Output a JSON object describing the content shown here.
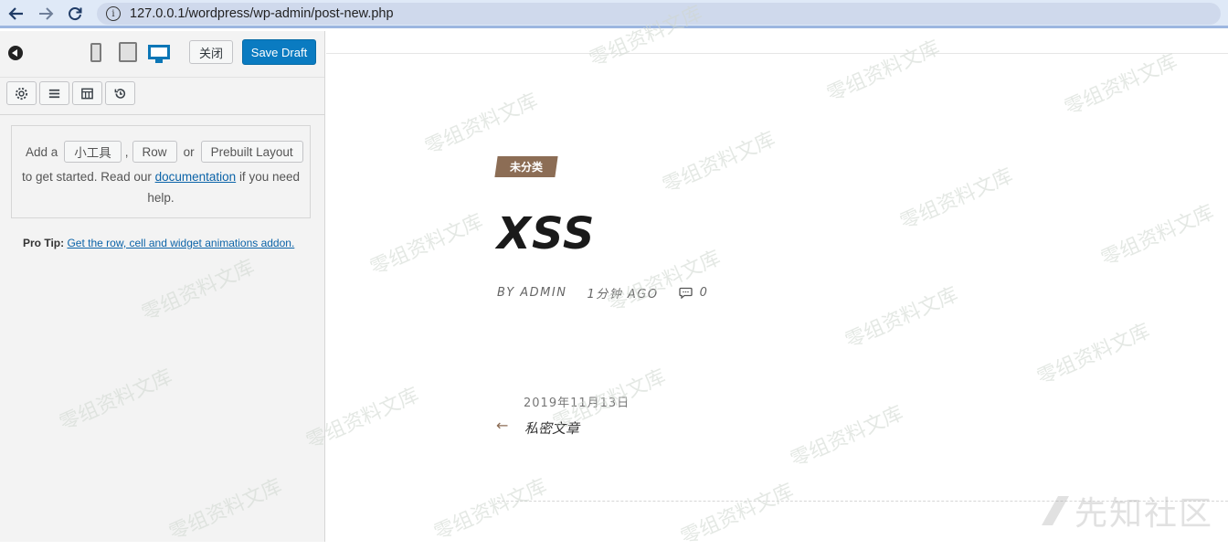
{
  "browser": {
    "url": "127.0.0.1/wordpress/wp-admin/post-new.php"
  },
  "panel": {
    "close_label": "关闭",
    "save_label": "Save Draft",
    "add_prefix": "Add a",
    "widget_btn": "小工具",
    "comma": ",",
    "row_btn": "Row",
    "or_text": "or",
    "prebuilt_btn": "Prebuilt Layout",
    "started_text": "to get started. Read our",
    "doc_link": "documentation",
    "need_text": "if you need",
    "help_text": "help.",
    "protip_label": "Pro Tip:",
    "protip_link": "Get the row, cell and widget animations addon."
  },
  "preview": {
    "category": "未分类",
    "title": "XSS",
    "author": "BY ADMIN",
    "time": "1分钟 AGO",
    "comments": "0",
    "nav_date": "2019年11月13日",
    "nav_arrow": "←",
    "nav_title": "私密文章"
  },
  "watermark": {
    "text": "先知社区",
    "repeat": "零组资料文库"
  },
  "colors": {
    "accent": "#0a7bc1",
    "badge": "#8c6d55"
  }
}
